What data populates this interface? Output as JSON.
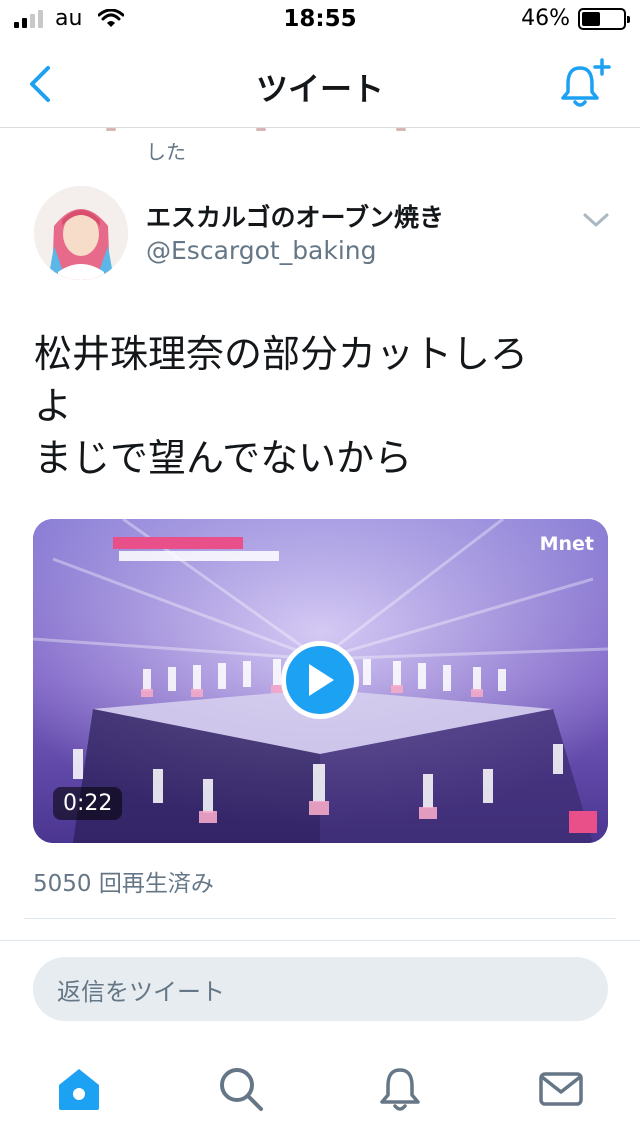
{
  "status_bar": {
    "carrier": "au",
    "time": "18:55",
    "battery": "46%",
    "battery_level": 0.46
  },
  "nav": {
    "title": "ツイート",
    "accent_color": "#1da1f2"
  },
  "previous_tweet": {
    "fragment": "した"
  },
  "tweet": {
    "author_name": "エスカルゴのオーブン焼き",
    "author_handle": "@Escargot_baking",
    "text_lines": [
      "松井珠理奈の部分カットしろ",
      "よ",
      "まじで望んでないから"
    ],
    "video": {
      "duration": "0:22",
      "watermark": "Mnet"
    },
    "views": "5050 回再生済み"
  },
  "reply": {
    "placeholder": "返信をツイート"
  },
  "tabs": [
    {
      "icon": "home-icon",
      "active": true
    },
    {
      "icon": "search-icon",
      "active": false
    },
    {
      "icon": "bell-icon",
      "active": false
    },
    {
      "icon": "mail-icon",
      "active": false
    }
  ]
}
